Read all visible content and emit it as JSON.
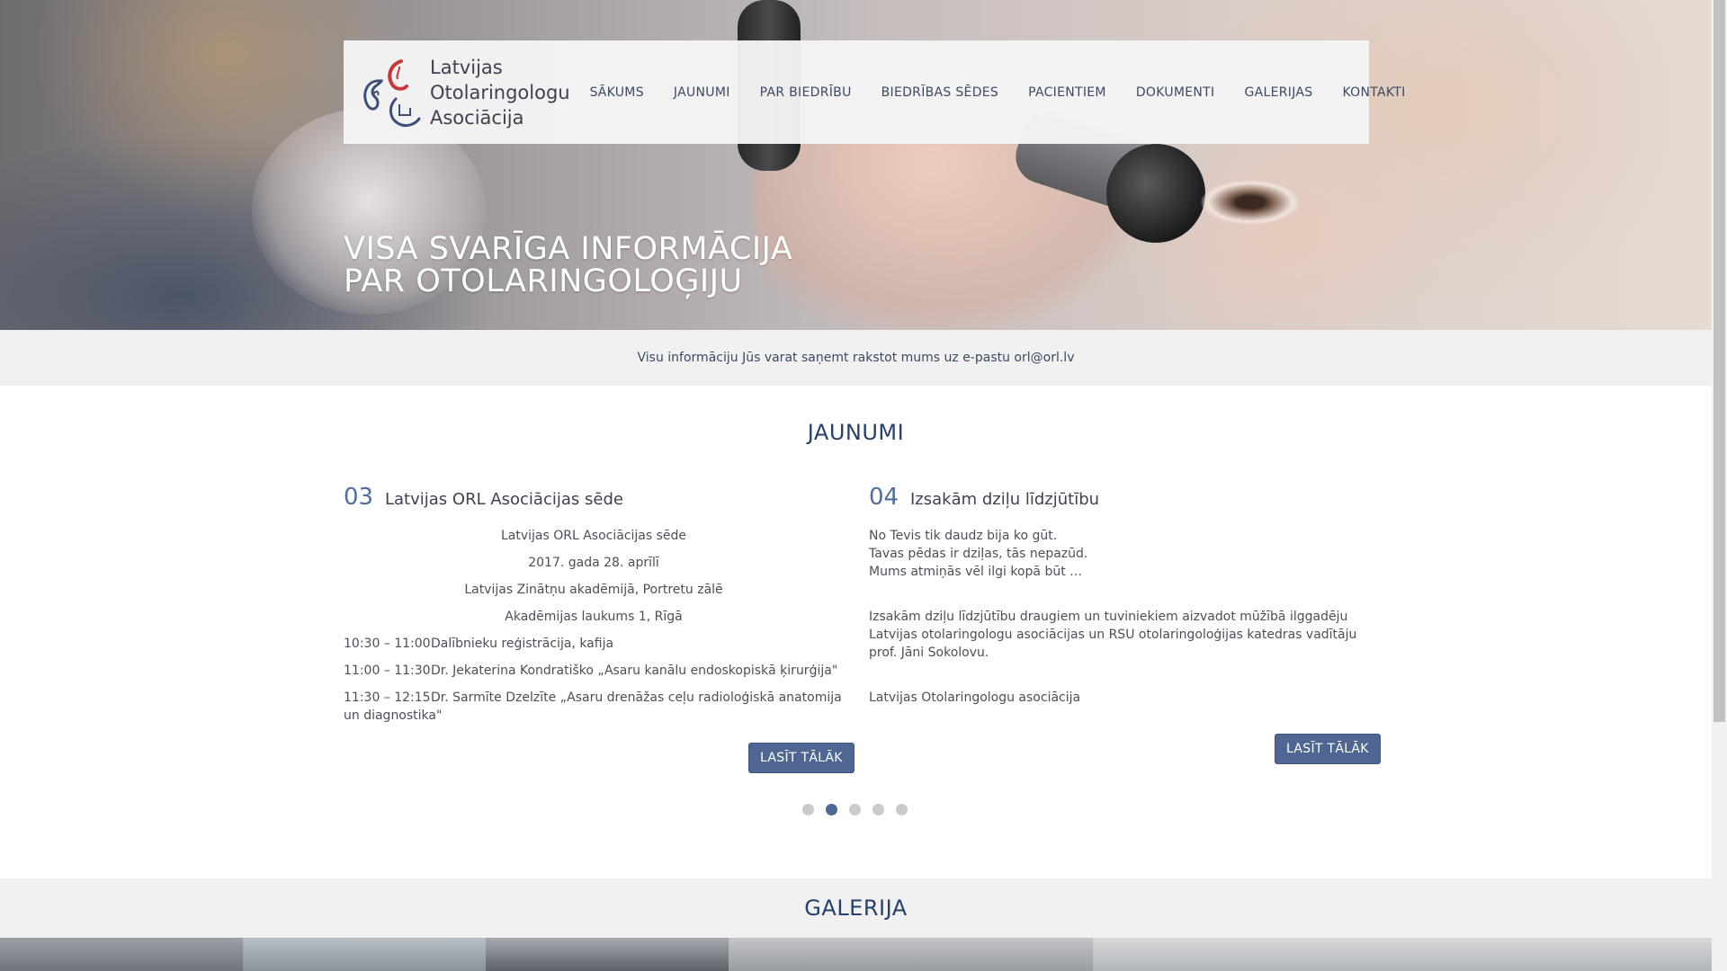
{
  "hero": {
    "title_line1": "VISA SVARĪGA INFORMĀCIJA",
    "title_line2": "PAR OTOLARINGOLOĢIJU"
  },
  "logo": {
    "line1": "Latvijas",
    "line2": "Otolaringologu",
    "line3": "Asociācija",
    "icon": "ear-throat-logo-icon"
  },
  "nav": [
    "SĀKUMS",
    "JAUNUMI",
    "PAR BIEDRĪBU",
    "BIEDRĪBAS SĒDES",
    "PACIENTIEM",
    "DOKUMENTI",
    "GALERIJAS",
    "KONTAKTI"
  ],
  "info_strip": "Visu informāciju Jūs varat saņemt rakstot mums uz e-pastu orl@orl.lv",
  "news": {
    "section_title": "JAUNUMI",
    "items": [
      {
        "number": "03",
        "title": "Latvijas ORL Asociācijas sēde",
        "center_lines": [
          "Latvijas ORL Asociācijas sēde",
          "2017. gada 28. aprīlī",
          "Latvijas Zinātņu akadēmijā, Portretu zālē",
          "Akadēmijas laukums 1, Rīgā"
        ],
        "schedule": [
          {
            "time": "10:30 – 11:00",
            "text": "Dalībnieku reģistrācija, kafija"
          },
          {
            "time": "11:00 – 11:30",
            "text": "Dr. Jekaterina Kondratiško „Asaru kanālu endoskopiskā ķirurģija\""
          },
          {
            "time": "11:30 – 12:15",
            "text": "Dr. Sarmīte Dzelzīte „Asaru drenāžas ceļu radioloģiskā anatomija un diagnostika\""
          }
        ],
        "button": "LASĪT TĀLĀK"
      },
      {
        "number": "04",
        "title": "Izsakām dziļu līdzjūtību",
        "poem": [
          "No Tevis tik daudz bija ko gūt.",
          "Tavas pēdas ir dziļas, tās nepazūd.",
          "Mums atmiņās vēl ilgi kopā būt …"
        ],
        "paragraph": "Izsakām dziļu līdzjūtību draugiem un tuviniekiem aizvadot mūžībā ilggadēju Latvijas otolaringologu asociācijas un RSU otolaringoloģijas katedras vadītāju prof. Jāni Sokolovu.",
        "signature": "Latvijas Otolaringologu asociācija",
        "button": "LASĪT TĀLĀK"
      }
    ],
    "pager": {
      "count": 5,
      "active": 2
    }
  },
  "gallery": {
    "section_title": "GALERIJA"
  },
  "colors": {
    "accent": "#4e6691",
    "heading": "#27406b",
    "band": "#f1f1f2"
  }
}
